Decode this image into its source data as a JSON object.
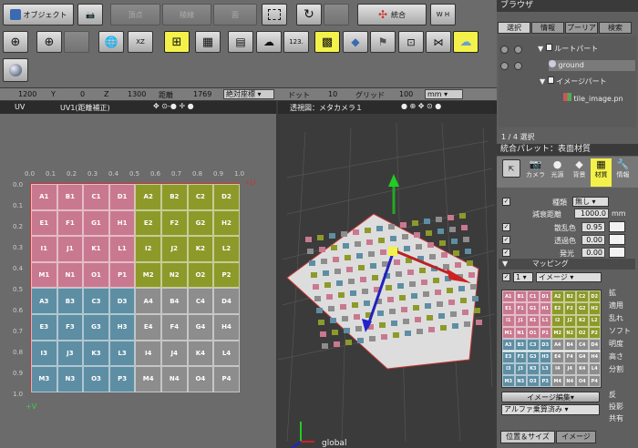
{
  "toolbar": {
    "object_label": "オブジェクト",
    "vertex_label": "頂点",
    "edge_label": "稜線",
    "face_label": "面",
    "unify_label": "統合",
    "wh_label": "W H",
    "num_label": "123."
  },
  "coords": {
    "x_label": "X",
    "x_value": "1200",
    "y_label": "Y",
    "y_value": "0",
    "z_label": "Z",
    "z_value": "1300",
    "dist_label": "距離",
    "dist_value": "1769",
    "mode_value": "絶対座標",
    "dot_label": "ドット",
    "dot_value": "10",
    "grid_label": "グリッド",
    "grid_value": "100",
    "unit_value": "mm"
  },
  "uv_panel": {
    "title": "UV",
    "subtitle": "UV1(距離補正)",
    "ticks_top": [
      "0.0",
      "0.1",
      "0.2",
      "0.3",
      "0.4",
      "0.5",
      "0.6",
      "0.7",
      "0.8",
      "0.9",
      "1.0"
    ],
    "ticks_left": [
      "0.0",
      "0.1",
      "0.2",
      "0.3",
      "0.4",
      "0.5",
      "0.6",
      "0.7",
      "0.8",
      "0.9",
      "1.0"
    ],
    "v_label": "+V",
    "u_label": "+U",
    "cells": [
      [
        "A1",
        "B1",
        "C1",
        "D1",
        "A2",
        "B2",
        "C2",
        "D2"
      ],
      [
        "E1",
        "F1",
        "G1",
        "H1",
        "E2",
        "F2",
        "G2",
        "H2"
      ],
      [
        "I1",
        "J1",
        "K1",
        "L1",
        "I2",
        "J2",
        "K2",
        "L2"
      ],
      [
        "M1",
        "N1",
        "O1",
        "P1",
        "M2",
        "N2",
        "O2",
        "P2"
      ],
      [
        "A3",
        "B3",
        "C3",
        "D3",
        "A4",
        "B4",
        "C4",
        "D4"
      ],
      [
        "E3",
        "F3",
        "G3",
        "H3",
        "E4",
        "F4",
        "G4",
        "H4"
      ],
      [
        "I3",
        "J3",
        "K3",
        "L3",
        "I4",
        "J4",
        "K4",
        "L4"
      ],
      [
        "M3",
        "N3",
        "O3",
        "P3",
        "M4",
        "N4",
        "O4",
        "P4"
      ]
    ]
  },
  "persp": {
    "title": "透視図：メタカメラ１",
    "global_label": "global"
  },
  "browser": {
    "title": "ブラウザ",
    "tabs": [
      "選択",
      "情報",
      "プーリア",
      "検索"
    ],
    "items": [
      "ルートパート",
      "ground",
      "イメージパート",
      "tile_image.pn"
    ],
    "status": "1 / 4 選択"
  },
  "palette": {
    "title": "統合パレット：表面材質",
    "tabs": [
      "カメラ",
      "光源",
      "背景",
      "材質",
      "情報"
    ],
    "kind_label": "種類",
    "kind_value": "無し",
    "atten_label": "減衰距離",
    "atten_value": "1000.0",
    "atten_unit": "mm",
    "scatter_label": "散乱色",
    "scatter_value": "0.95",
    "trans_label": "透過色",
    "trans_value": "0.00",
    "emit_label": "発光",
    "emit_value": "0.00",
    "mapping_label": "マッピング",
    "layer_num": "1",
    "layer_type": "イメージ",
    "edit_label": "イメージ編集",
    "alpha_label": "アルファ乗算済み",
    "side": [
      "拡",
      "適用",
      "乱れ",
      "ソフト",
      "明度",
      "高さ",
      "分割"
    ],
    "side2": [
      "反",
      "投影",
      "共有"
    ],
    "pos_tab": "位置＆サイズ",
    "img_tab": "イメージ",
    "swatch_cells": [
      "A1",
      "B1",
      "C1",
      "D1",
      "A2",
      "B2",
      "C2",
      "D2",
      "E1",
      "F1",
      "G1",
      "H1",
      "E2",
      "F2",
      "G2",
      "H2",
      "I1",
      "J1",
      "K1",
      "L1",
      "I2",
      "J2",
      "K2",
      "L2",
      "M1",
      "N1",
      "O1",
      "P1",
      "M2",
      "N2",
      "O2",
      "P2",
      "A3",
      "B3",
      "C3",
      "D3",
      "A4",
      "B4",
      "C4",
      "D4",
      "E3",
      "F3",
      "G3",
      "H3",
      "E4",
      "F4",
      "G4",
      "H4",
      "I3",
      "J3",
      "K3",
      "L3",
      "I4",
      "J4",
      "K4",
      "L4",
      "M3",
      "N3",
      "O3",
      "P3",
      "M4",
      "N4",
      "O4",
      "P4"
    ]
  },
  "colors": {
    "pink": "#c9798f",
    "olive": "#8d9a2a",
    "blue": "#5e8ea3",
    "gray": "#8d8d8d"
  }
}
